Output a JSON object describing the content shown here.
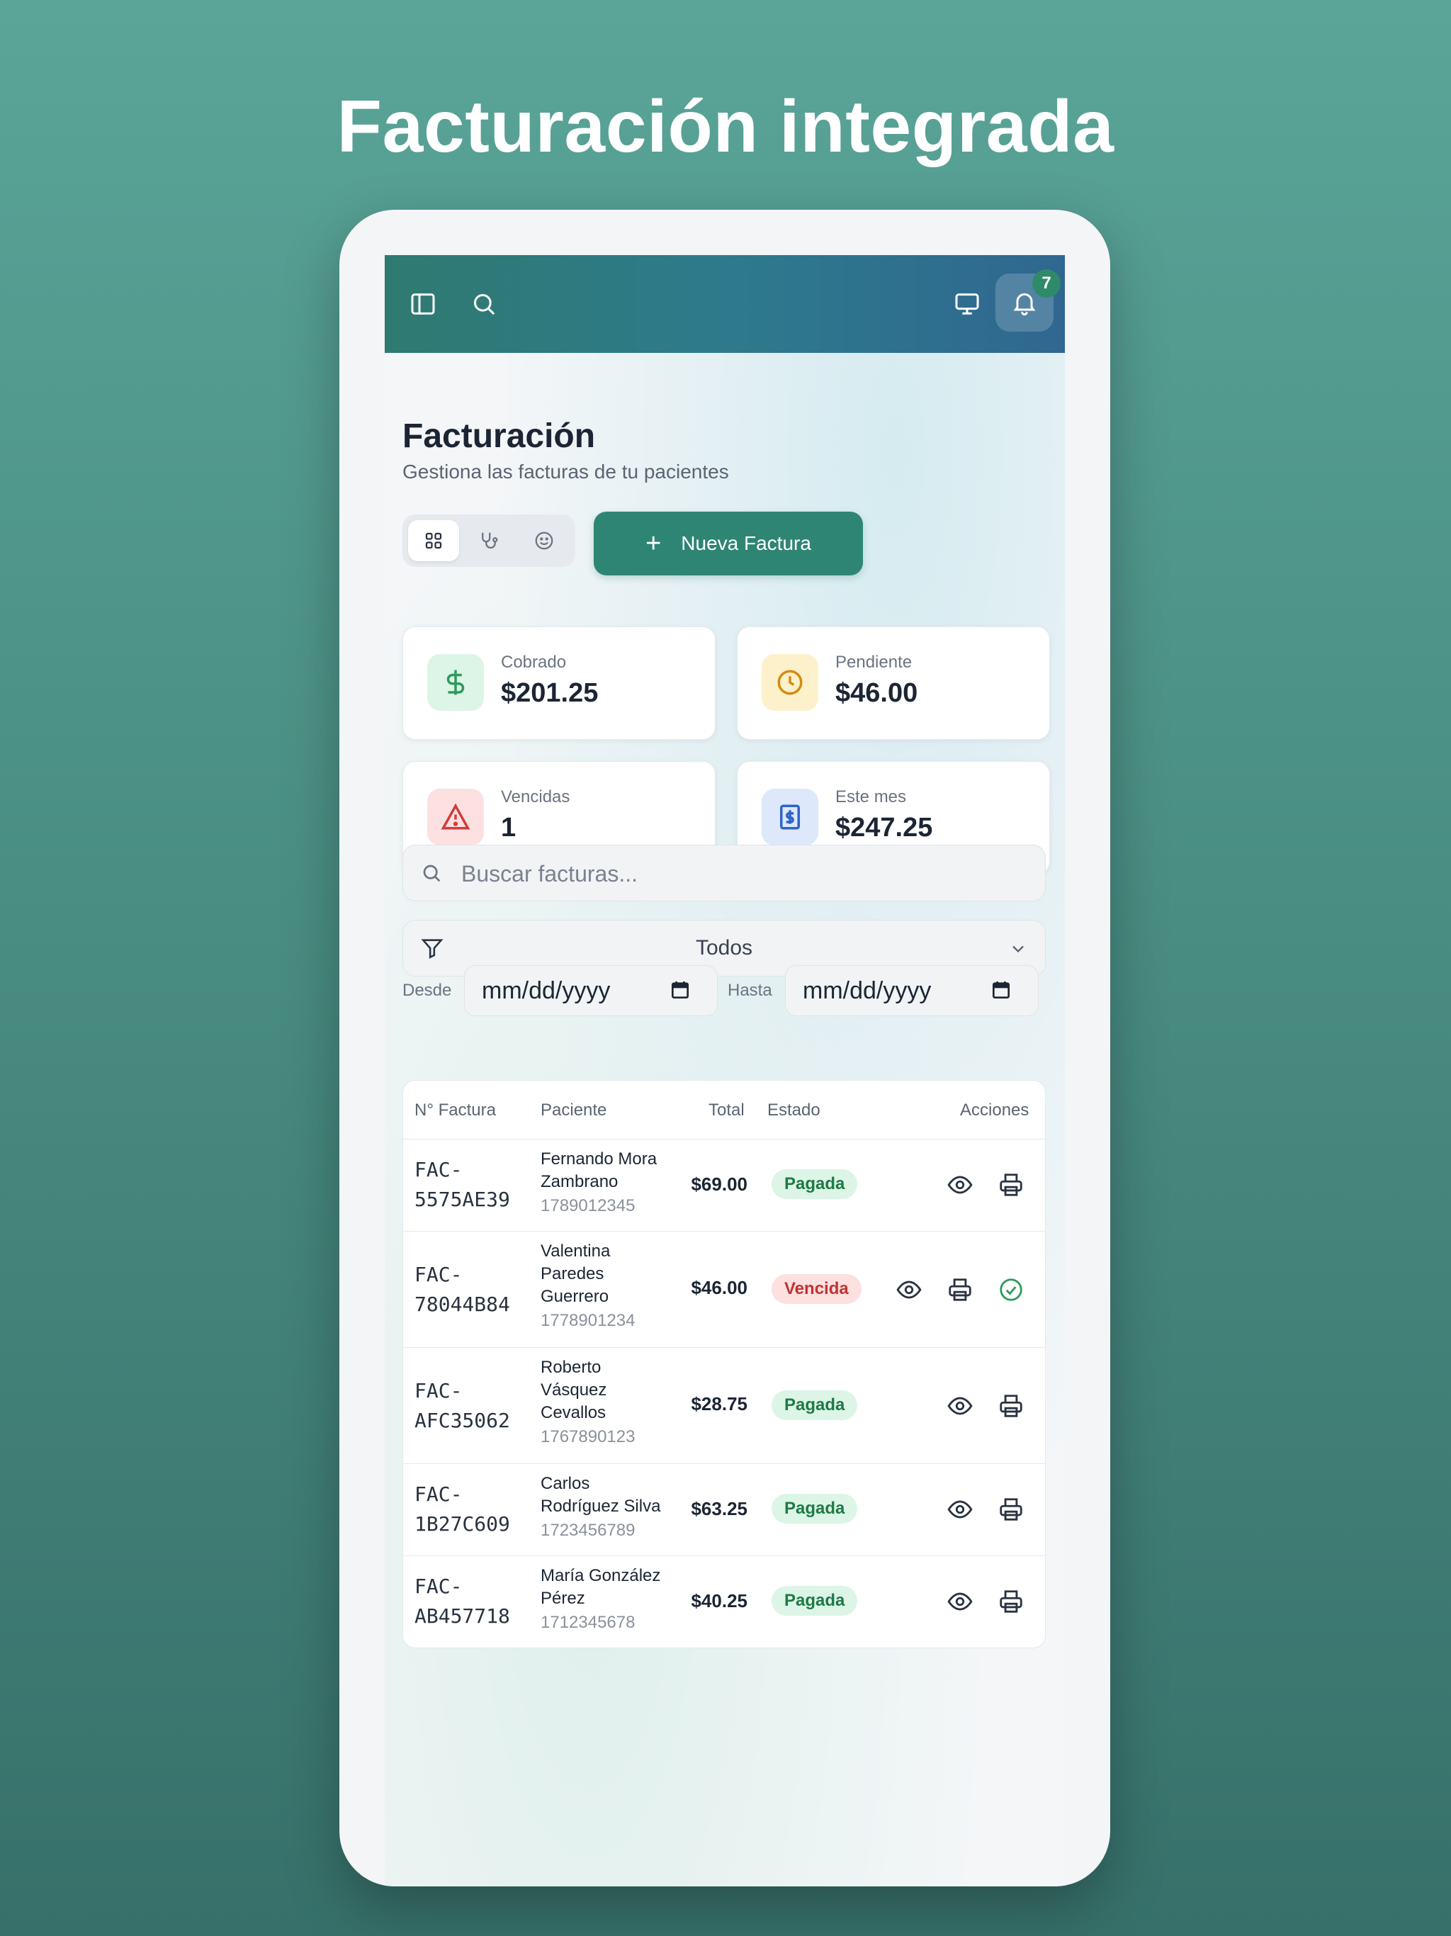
{
  "promo": {
    "title": "Facturación integrada"
  },
  "topbar": {
    "sidebar_icon": "sidebar-icon",
    "search_icon": "search-icon",
    "monitor_icon": "monitor-icon",
    "bell_icon": "bell-icon",
    "notification_count": "7"
  },
  "page": {
    "title": "Facturación",
    "subtitle": "Gestiona las facturas de tu pacientes"
  },
  "view_switcher": {
    "options": [
      "grid-icon",
      "stethoscope-icon",
      "smile-icon"
    ],
    "active_index": 0
  },
  "new_button": {
    "label": "Nueva Factura"
  },
  "stats": [
    {
      "label": "Cobrado",
      "value": "$201.25",
      "icon": "dollar-icon",
      "color": "#2f9a5c",
      "bg": "#dcf5e6"
    },
    {
      "label": "Pendiente",
      "value": "$46.00",
      "icon": "clock-icon",
      "color": "#d68a10",
      "bg": "#fdf1cc"
    },
    {
      "label": "Vencidas",
      "value": "1",
      "icon": "alert-triangle-icon",
      "color": "#d23b3b",
      "bg": "#fde0e0"
    },
    {
      "label": "Este mes",
      "value": "$247.25",
      "icon": "receipt-icon",
      "color": "#2f64c8",
      "bg": "#dde8fb"
    }
  ],
  "search": {
    "placeholder": "Buscar facturas...",
    "value": ""
  },
  "filter": {
    "value": "Todos"
  },
  "date_range": {
    "from_label": "Desde",
    "from_value": "mm/dd/yyyy",
    "to_label": "Hasta",
    "to_value": "mm/dd/yyyy"
  },
  "table": {
    "headers": {
      "number": "N° Factura",
      "patient": "Paciente",
      "total": "Total",
      "status": "Estado",
      "actions": "Acciones"
    },
    "rows": [
      {
        "number_a": "FAC-",
        "number_b": "5575AE39",
        "name_lines": [
          "Fernando Mora",
          "Zambrano"
        ],
        "id": "1789012345",
        "total": "$69.00",
        "status": "Pagada",
        "status_type": "paid"
      },
      {
        "number_a": "FAC-",
        "number_b": "78044B84",
        "name_lines": [
          "Valentina",
          "Paredes",
          "Guerrero"
        ],
        "id": "1778901234",
        "total": "$46.00",
        "status": "Vencida",
        "status_type": "overdue"
      },
      {
        "number_a": "FAC-",
        "number_b": "AFC35062",
        "name_lines": [
          "Roberto",
          "Vásquez",
          "Cevallos"
        ],
        "id": "1767890123",
        "total": "$28.75",
        "status": "Pagada",
        "status_type": "paid"
      },
      {
        "number_a": "FAC-",
        "number_b": "1B27C609",
        "name_lines": [
          "Carlos",
          "Rodríguez Silva"
        ],
        "id": "1723456789",
        "total": "$63.25",
        "status": "Pagada",
        "status_type": "paid"
      },
      {
        "number_a": "FAC-",
        "number_b": "AB457718",
        "name_lines": [
          "María González",
          "Pérez"
        ],
        "id": "1712345678",
        "total": "$40.25",
        "status": "Pagada",
        "status_type": "paid"
      }
    ]
  },
  "colors": {
    "accent": "#2f8573",
    "topbar_start": "#2f7a70",
    "topbar_end": "#2f6790"
  }
}
